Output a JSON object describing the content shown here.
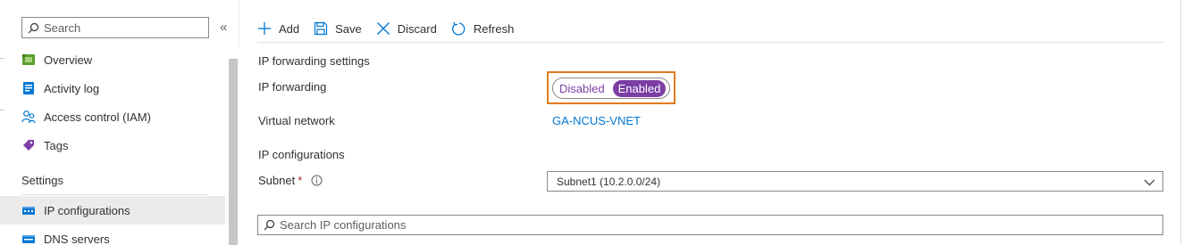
{
  "sidebar": {
    "search": {
      "placeholder": "Search"
    },
    "collapse_glyph": "«",
    "items": [
      {
        "label": "Overview",
        "icon": "overview-icon"
      },
      {
        "label": "Activity log",
        "icon": "activity-log-icon"
      },
      {
        "label": "Access control (IAM)",
        "icon": "access-control-icon"
      },
      {
        "label": "Tags",
        "icon": "tag-icon"
      }
    ],
    "settings_header": "Settings",
    "settings_items": [
      {
        "label": "IP configurations",
        "icon": "ip-configurations-icon",
        "active": true
      },
      {
        "label": "DNS servers",
        "icon": "dns-servers-icon"
      }
    ]
  },
  "toolbar": {
    "add_label": "Add",
    "save_label": "Save",
    "discard_label": "Discard",
    "refresh_label": "Refresh"
  },
  "main": {
    "ip_forwarding_settings_heading": "IP forwarding settings",
    "ip_forwarding_label": "IP forwarding",
    "toggle": {
      "off_label": "Disabled",
      "on_label": "Enabled",
      "selected": "Enabled"
    },
    "virtual_network_label": "Virtual network",
    "virtual_network_value": "GA-NCUS-VNET",
    "ip_configurations_heading": "IP configurations",
    "subnet_label": "Subnet",
    "subnet_required_mark": "*",
    "subnet_value": "Subnet1 (10.2.0.0/24)",
    "ip_search": {
      "placeholder": "Search IP configurations"
    }
  },
  "colors": {
    "accent_purple": "#7b3ea5",
    "highlight_orange": "#e07b1f",
    "link_blue": "#0078d4",
    "required_red": "#a4262c"
  }
}
